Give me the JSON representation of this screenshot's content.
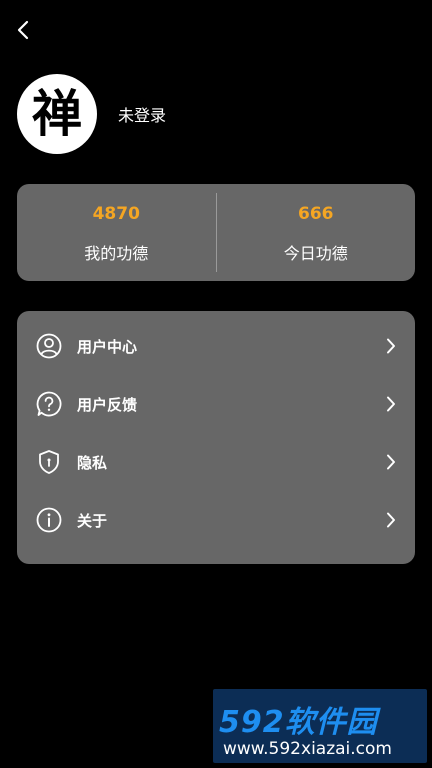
{
  "header": {
    "back_icon": "chevron-left-icon"
  },
  "profile": {
    "avatar_glyph": "禅",
    "login_status": "未登录"
  },
  "stats": {
    "accent_color": "#f5a623",
    "items": [
      {
        "value": "4870",
        "label": "我的功德"
      },
      {
        "value": "666",
        "label": "今日功德"
      }
    ]
  },
  "menu": {
    "items": [
      {
        "label": "用户中心",
        "icon": "user-circle-icon"
      },
      {
        "label": "用户反馈",
        "icon": "question-bubble-icon"
      },
      {
        "label": "隐私",
        "icon": "shield-icon"
      },
      {
        "label": "关于",
        "icon": "info-icon"
      }
    ]
  },
  "watermark": {
    "logo": "592软件园",
    "url": "www.592xiazai.com"
  }
}
